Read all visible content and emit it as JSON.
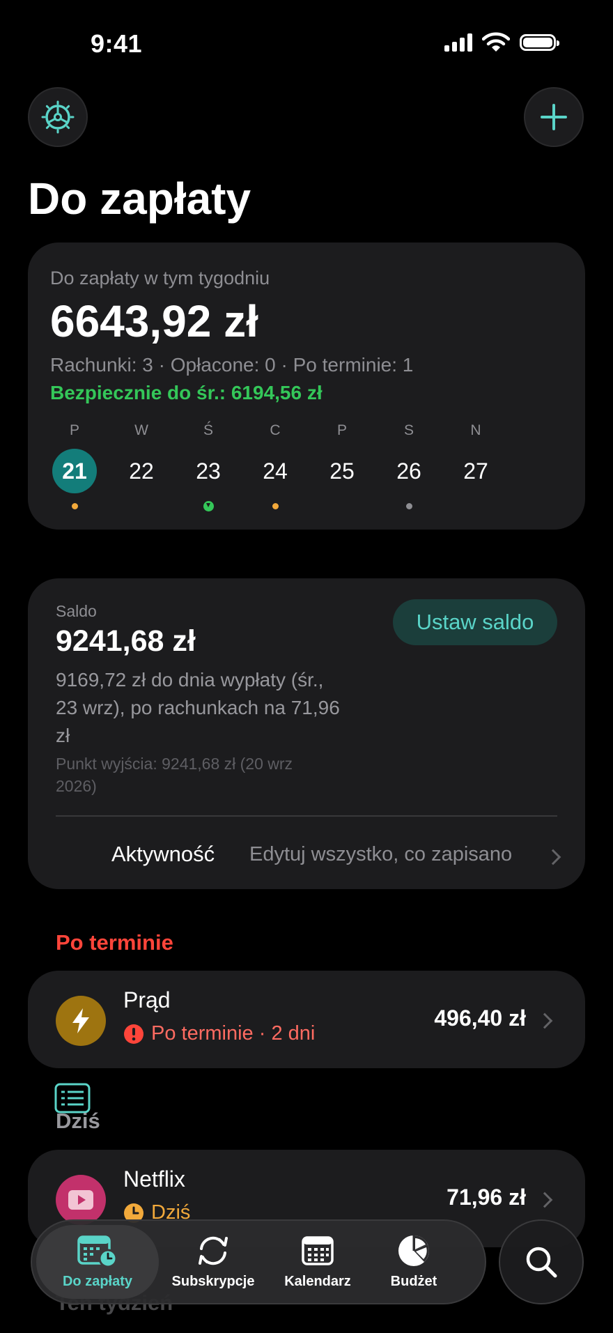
{
  "status_bar": {
    "time": "9:41"
  },
  "header": {
    "title": "Do zapłaty"
  },
  "colors": {
    "accent": "#5ad4c8",
    "selected_day": "#137d7a",
    "overdue": "#ff453a",
    "safe": "#34c759",
    "warning": "#f2a93b"
  },
  "week": {
    "label": "Do zapłaty w tym tygodniu",
    "amount": "6643,92 zł",
    "stats": "Rachunki: 3 · Opłacone: 0 · Po terminie: 1",
    "safe": "Bezpiecznie do śr.: 6194,56 zł",
    "days": [
      {
        "letter": "P",
        "num": "21",
        "selected": true,
        "dot": "orange"
      },
      {
        "letter": "W",
        "num": "22",
        "selected": false,
        "dot": ""
      },
      {
        "letter": "Ś",
        "num": "23",
        "selected": false,
        "dot": "green"
      },
      {
        "letter": "C",
        "num": "24",
        "selected": false,
        "dot": "orange"
      },
      {
        "letter": "P",
        "num": "25",
        "selected": false,
        "dot": ""
      },
      {
        "letter": "S",
        "num": "26",
        "selected": false,
        "dot": "gray"
      },
      {
        "letter": "N",
        "num": "27",
        "selected": false,
        "dot": ""
      }
    ]
  },
  "saldo": {
    "label": "Saldo",
    "amount": "9241,68 zł",
    "description": "9169,72 zł do dnia wypłaty (śr., 23 wrz), po rachunkach na 71,96 zł",
    "start_point": "Punkt wyjścia: 9241,68 zł (20 wrz 2026)",
    "set_button": "Ustaw saldo",
    "activity_label": "Aktywność",
    "activity_hint": "Edytuj wszystko, co zapisano"
  },
  "overdue_section": {
    "title": "Po terminie",
    "item": {
      "name": "Prąd",
      "status": "Po terminie · 2 dni",
      "amount": "496,40 zł",
      "icon": "bolt-icon"
    }
  },
  "today_section": {
    "title": "Dziś",
    "item": {
      "name": "Netflix",
      "status": "Dziś",
      "amount": "71,96 zł",
      "icon": "play-icon"
    }
  },
  "next_section": {
    "title": "Ten tydzień"
  },
  "tabs": [
    {
      "label": "Do zapłaty",
      "icon": "calendar-clock-icon",
      "active": true
    },
    {
      "label": "Subskrypcje",
      "icon": "refresh-icon",
      "active": false
    },
    {
      "label": "Kalendarz",
      "icon": "calendar-icon",
      "active": false
    },
    {
      "label": "Budżet",
      "icon": "pie-chart-icon",
      "active": false
    }
  ]
}
